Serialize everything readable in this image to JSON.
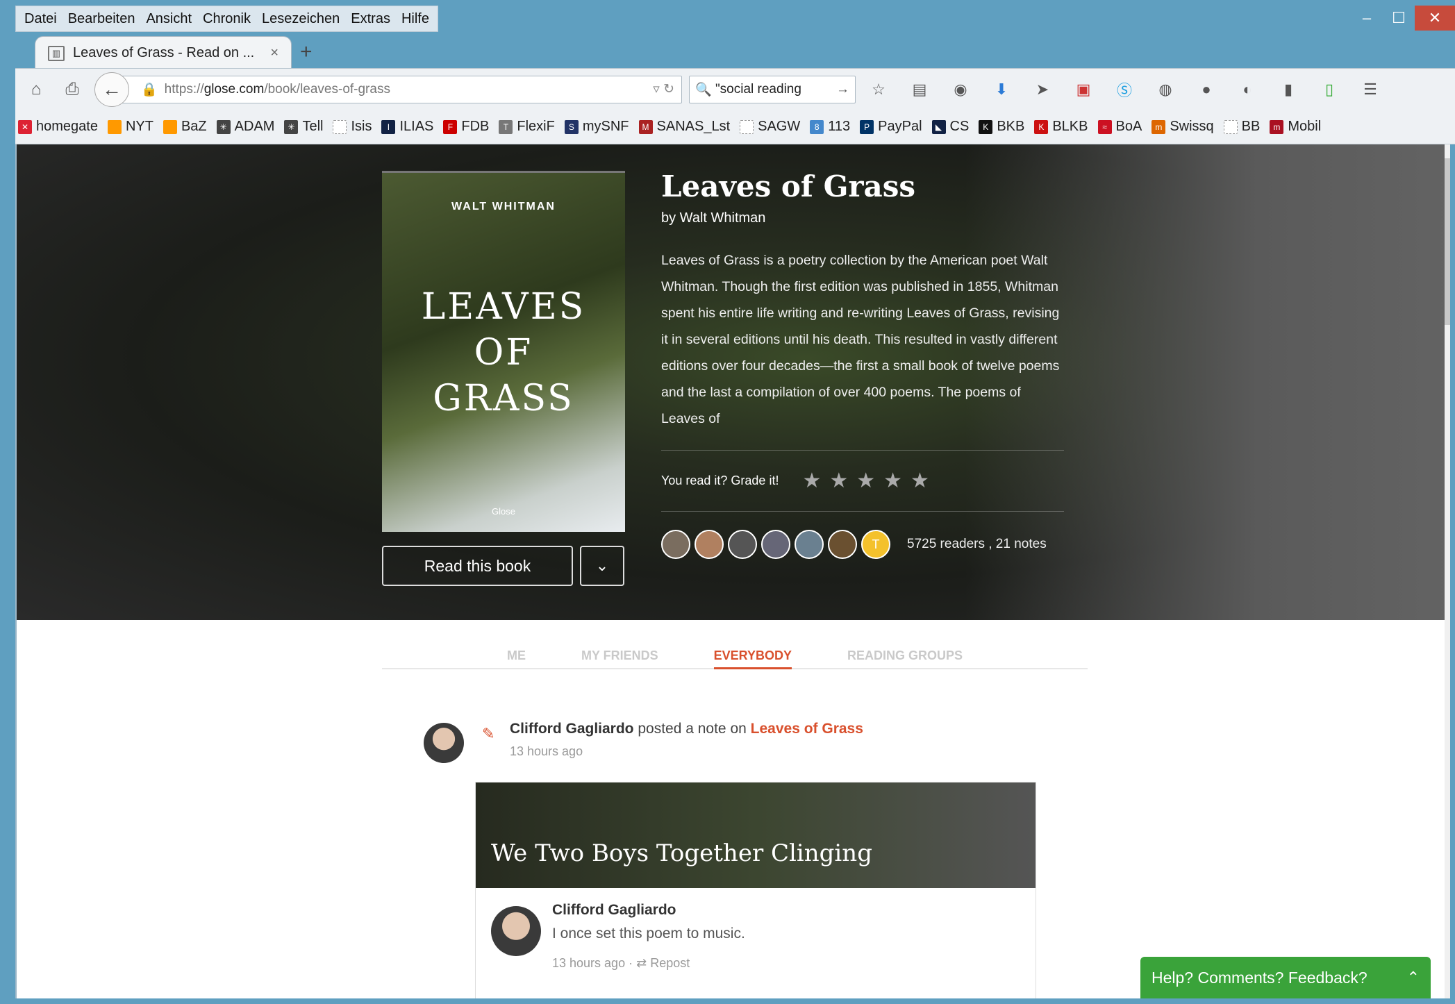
{
  "menu": [
    "Datei",
    "Bearbeiten",
    "Ansicht",
    "Chronik",
    "Lesezeichen",
    "Extras",
    "Hilfe"
  ],
  "tab": {
    "title": "Leaves of Grass - Read on ...",
    "close": "×",
    "new": "+"
  },
  "url": {
    "prefix": "https://",
    "host": "glose.com",
    "path": "/book/leaves-of-grass"
  },
  "search": {
    "value": "\"social reading"
  },
  "bookmarks": [
    {
      "label": "homegate",
      "color": "#d23"
    },
    {
      "label": "NYT",
      "color": "#f90"
    },
    {
      "label": "BaZ",
      "color": "#f90"
    },
    {
      "label": "ADAM",
      "color": "#444"
    },
    {
      "label": "Tell",
      "color": "#444"
    },
    {
      "label": "Isis",
      "color": "#bbb"
    },
    {
      "label": "ILIAS",
      "color": "#124"
    },
    {
      "label": "FDB",
      "color": "#c00"
    },
    {
      "label": "FlexiF",
      "color": "#777"
    },
    {
      "label": "mySNF",
      "color": "#236"
    },
    {
      "label": "SANAS_Lst",
      "color": "#a22"
    },
    {
      "label": "SAGW",
      "color": "#bbb"
    },
    {
      "label": "113",
      "color": "#48c"
    },
    {
      "label": "PayPal",
      "color": "#036"
    },
    {
      "label": "CS",
      "color": "#124"
    },
    {
      "label": "BKB",
      "color": "#111"
    },
    {
      "label": "BLKB",
      "color": "#c11"
    },
    {
      "label": "BoA",
      "color": "#c12"
    },
    {
      "label": "Swissq",
      "color": "#d60"
    },
    {
      "label": "BB",
      "color": "#bbb"
    },
    {
      "label": "Mobil",
      "color": "#a12"
    }
  ],
  "book": {
    "cover_author": "WALT WHITMAN",
    "cover_title_1": "LEAVES",
    "cover_title_2": "OF",
    "cover_title_3": "GRASS",
    "cover_publisher": "Glose",
    "title": "Leaves of Grass",
    "by": "by Walt Whitman",
    "description": "Leaves of Grass is a poetry collection by the American poet Walt Whitman. Though the first edition was published in 1855, Whitman spent his entire life writing and re-writing Leaves of Grass, revising it in several editions until his death. This resulted in vastly different editions over four decades—the first a small book of twelve poems and the last a compilation of over 400 poems. The poems of Leaves of",
    "grade_label": "You read it? Grade it!",
    "stars": "★★★★★",
    "readers_label": "5725 readers , 21 notes",
    "avatar_initial": "T",
    "read_button": "Read this book"
  },
  "tabs": [
    "ME",
    "MY FRIENDS",
    "EVERYBODY",
    "READING GROUPS"
  ],
  "activity": {
    "user": "Clifford Gagliardo",
    "action": "posted a note on",
    "target": "Leaves of Grass",
    "time": "13 hours ago"
  },
  "card": {
    "title": "We Two Boys Together Clinging",
    "user": "Clifford Gagliardo",
    "text": "I once set this poem to music.",
    "time": "13 hours ago",
    "repost": "Repost"
  },
  "feedback": "Help? Comments? Feedback?"
}
